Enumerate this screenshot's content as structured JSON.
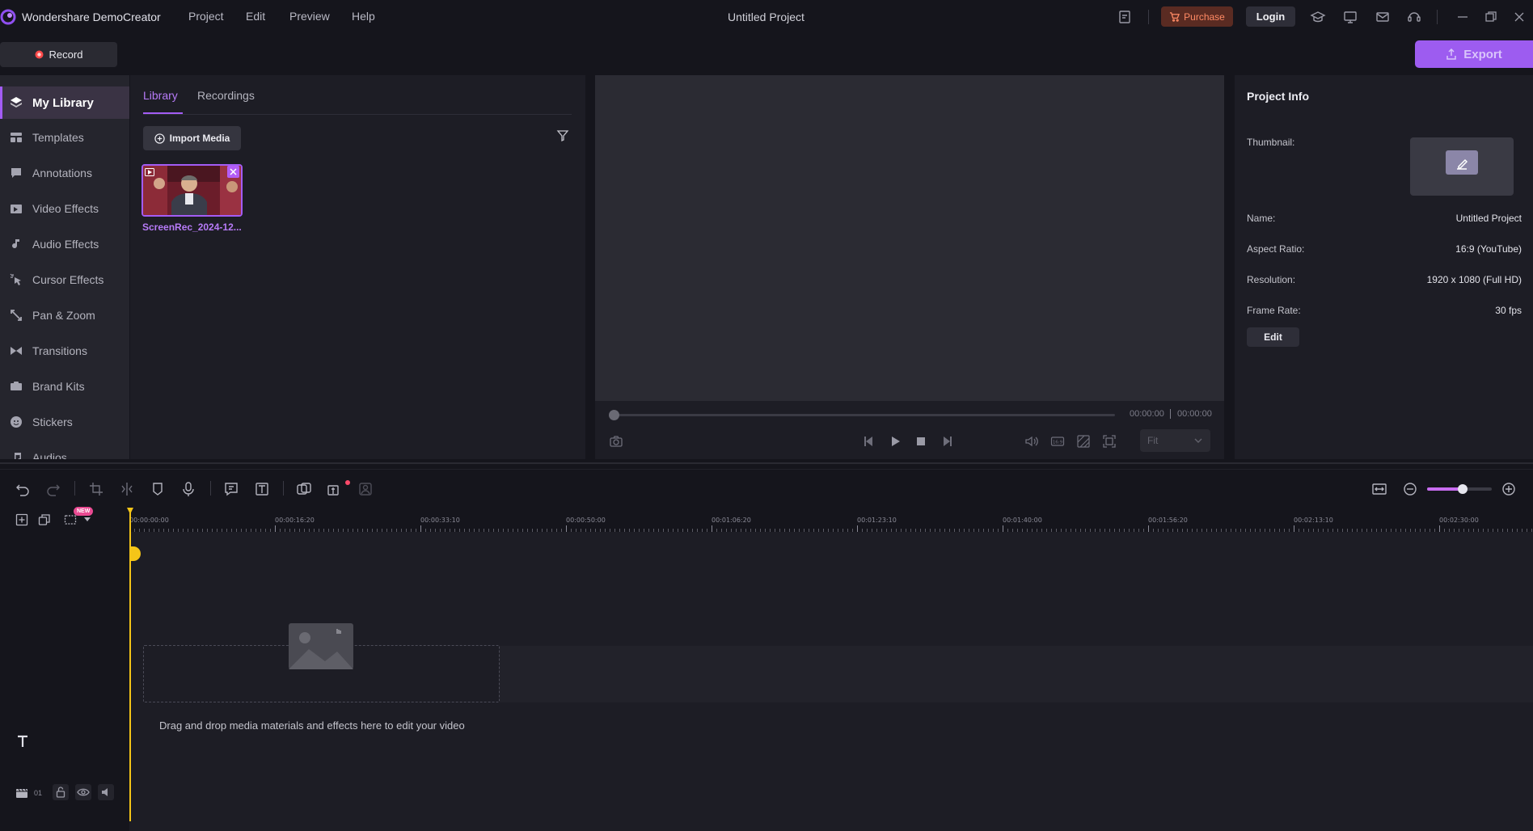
{
  "app": {
    "name": "Wondershare DemoCreator",
    "project_title": "Untitled Project"
  },
  "menu": [
    "Project",
    "Edit",
    "Preview",
    "Help"
  ],
  "titlebar": {
    "purchase_label": "Purchase",
    "login_label": "Login"
  },
  "record_label": "Record",
  "export_label": "Export",
  "sidebar": {
    "items": [
      {
        "label": "My Library",
        "icon": "layers-icon"
      },
      {
        "label": "Templates",
        "icon": "templates-icon"
      },
      {
        "label": "Annotations",
        "icon": "annotation-icon"
      },
      {
        "label": "Video Effects",
        "icon": "video-effects-icon"
      },
      {
        "label": "Audio Effects",
        "icon": "audio-effects-icon"
      },
      {
        "label": "Cursor Effects",
        "icon": "cursor-effects-icon"
      },
      {
        "label": "Pan & Zoom",
        "icon": "pan-zoom-icon"
      },
      {
        "label": "Transitions",
        "icon": "transitions-icon"
      },
      {
        "label": "Brand Kits",
        "icon": "brand-kits-icon"
      },
      {
        "label": "Stickers",
        "icon": "stickers-icon"
      },
      {
        "label": "Audios",
        "icon": "audios-icon"
      }
    ]
  },
  "library": {
    "tabs": [
      "Library",
      "Recordings"
    ],
    "import_label": "Import Media",
    "media": [
      {
        "name": "ScreenRec_2024-12..."
      }
    ]
  },
  "preview": {
    "current_time": "00:00:00",
    "total_time": "00:00:00",
    "fit_option": "Fit",
    "aspect_icon_label": "16:9"
  },
  "project_info": {
    "title": "Project Info",
    "thumbnail_label": "Thumbnail:",
    "fields": [
      {
        "label": "Name:",
        "value": "Untitled Project"
      },
      {
        "label": "Aspect Ratio:",
        "value": "16:9 (YouTube)"
      },
      {
        "label": "Resolution:",
        "value": "1920 x 1080 (Full HD)"
      },
      {
        "label": "Frame Rate:",
        "value": "30 fps"
      }
    ],
    "edit_label": "Edit"
  },
  "timeline": {
    "new_badge": "NEW",
    "ruler_labels": [
      "00:00:00:00",
      "00:00:16:20",
      "00:00:33:10",
      "00:00:50:00",
      "00:01:06:20",
      "00:01:23:10",
      "00:01:40:00",
      "00:01:56:20",
      "00:02:13:10",
      "00:02:30:00"
    ],
    "drop_hint": "Drag and drop media materials and effects here to edit your video",
    "track_number": "01",
    "zoom_level": 0.55
  },
  "colors": {
    "accent": "#a35cf5",
    "playhead": "#f5c518",
    "purchase": "#ff8a64"
  }
}
